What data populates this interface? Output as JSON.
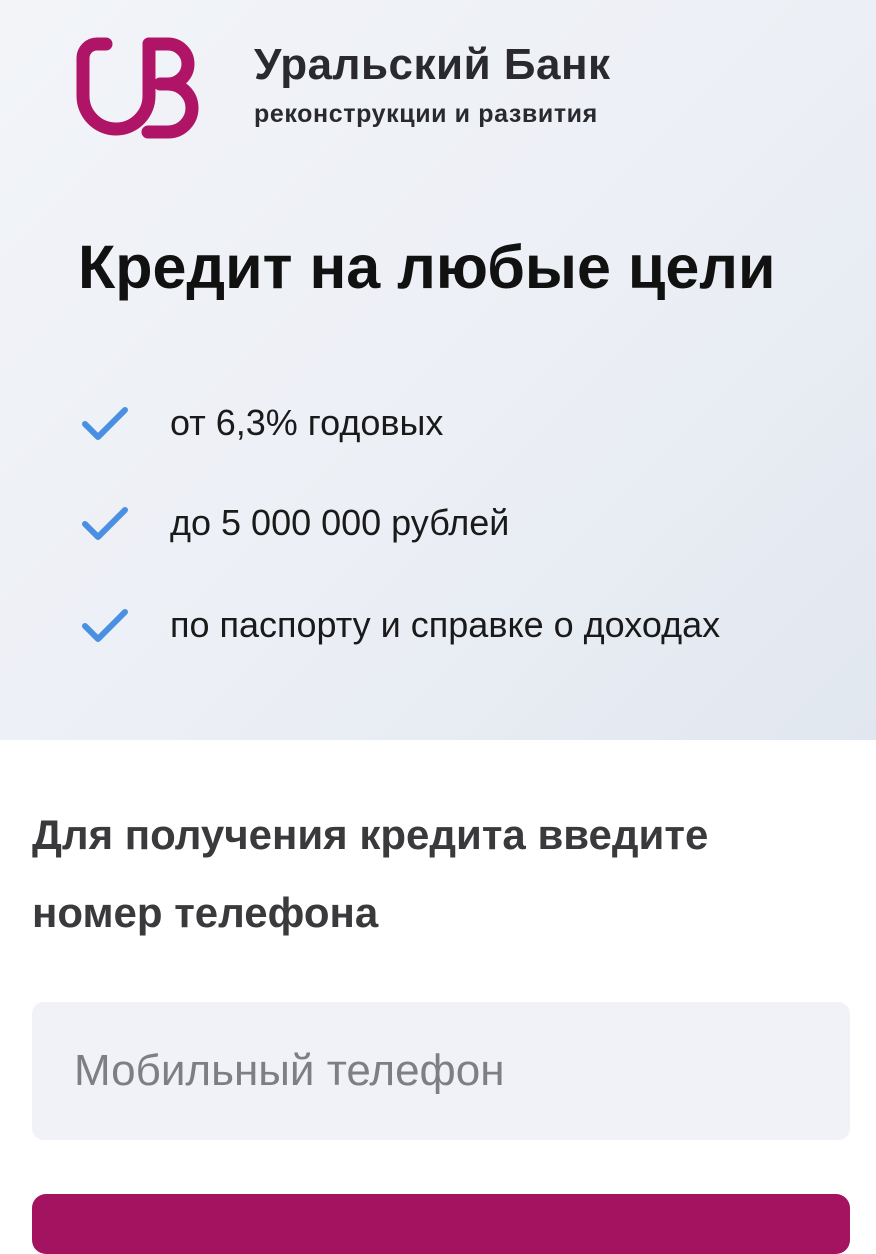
{
  "brand": {
    "name": "Уральский Банк",
    "subtitle": "реконструкции и развития",
    "logo_color": "#b01466"
  },
  "hero": {
    "title": "Кредит на любые цели",
    "features": [
      {
        "icon": "check-icon",
        "text": "от 6,3% годовых"
      },
      {
        "icon": "check-icon",
        "text": "до 5 000 000 рублей"
      },
      {
        "icon": "check-icon",
        "text": "по паспорту и справке о доходах"
      }
    ],
    "check_color": "#4a90e2"
  },
  "form": {
    "prompt": "Для получения кредита введите номер телефона",
    "phone_value": "",
    "phone_placeholder": "Мобильный телефон",
    "button_color": "#a4135f"
  }
}
